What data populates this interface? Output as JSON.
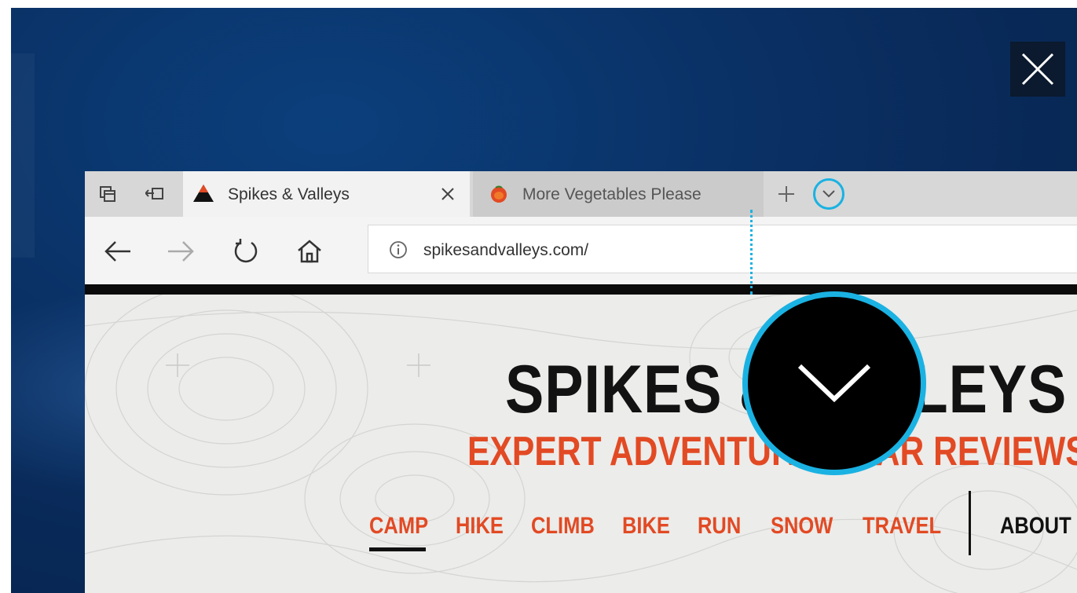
{
  "colors": {
    "accent": "#1ab2e2",
    "brand_orange": "#e24a24",
    "desktop_blue": "#0a2f62"
  },
  "overlay": {
    "close_icon": "close-icon"
  },
  "browser": {
    "tabbar": {
      "set_aside_icon": "tab-set-aside-icon",
      "tabs_aside_icon": "tabs-aside-icon",
      "tabs": [
        {
          "title": "Spikes & Valleys",
          "icon": "spikes-logo-icon",
          "active": true
        },
        {
          "title": "More Vegetables Please",
          "icon": "vegetable-icon",
          "active": false
        }
      ],
      "new_tab_icon": "plus-icon",
      "tab_preview_icon": "chevron-down-icon"
    },
    "nav": {
      "back_icon": "back-arrow-icon",
      "forward_icon": "forward-arrow-icon",
      "refresh_icon": "refresh-icon",
      "home_icon": "home-icon",
      "address": "spikesandvalleys.com/",
      "info_icon": "info-icon"
    }
  },
  "site": {
    "title": "SPIKES & VALLEYS",
    "tagline": "EXPERT ADVENTURE GEAR REVIEWS",
    "nav_links": [
      "CAMP",
      "HIKE",
      "CLIMB",
      "BIKE",
      "RUN",
      "SNOW",
      "TRAVEL"
    ],
    "about": "ABOUT",
    "active_link": "CAMP"
  },
  "callout": {
    "icon": "chevron-down-icon"
  }
}
